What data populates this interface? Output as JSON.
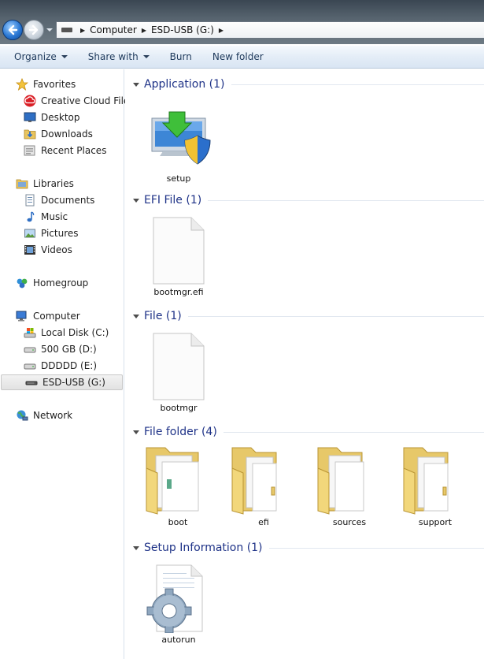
{
  "breadcrumb": [
    "Computer",
    "ESD-USB (G:)"
  ],
  "toolbar": {
    "organize": "Organize",
    "share_with": "Share with",
    "burn": "Burn",
    "new_folder": "New folder"
  },
  "nav": {
    "favorites": {
      "label": "Favorites",
      "items": [
        "Creative Cloud Files",
        "Desktop",
        "Downloads",
        "Recent Places"
      ]
    },
    "libraries": {
      "label": "Libraries",
      "items": [
        "Documents",
        "Music",
        "Pictures",
        "Videos"
      ]
    },
    "homegroup": "Homegroup",
    "computer": {
      "label": "Computer",
      "items": [
        "Local Disk (C:)",
        "500 GB (D:)",
        "DDDDD (E:)",
        "ESD-USB (G:)"
      ],
      "selected": "ESD-USB (G:)"
    },
    "network": "Network"
  },
  "groups": [
    {
      "title": "Application (1)",
      "items": [
        {
          "name": "setup",
          "icon": "setup-app-icon"
        }
      ]
    },
    {
      "title": "EFI File (1)",
      "items": [
        {
          "name": "bootmgr.efi",
          "icon": "blank-file-icon"
        }
      ]
    },
    {
      "title": "File (1)",
      "items": [
        {
          "name": "bootmgr",
          "icon": "blank-file-icon"
        }
      ]
    },
    {
      "title": "File folder (4)",
      "items": [
        {
          "name": "boot",
          "icon": "folder-icon"
        },
        {
          "name": "efi",
          "icon": "folder-icon"
        },
        {
          "name": "sources",
          "icon": "folder-icon"
        },
        {
          "name": "support",
          "icon": "folder-icon"
        }
      ]
    },
    {
      "title": "Setup Information (1)",
      "items": [
        {
          "name": "autorun",
          "icon": "setup-information-icon"
        }
      ]
    }
  ]
}
